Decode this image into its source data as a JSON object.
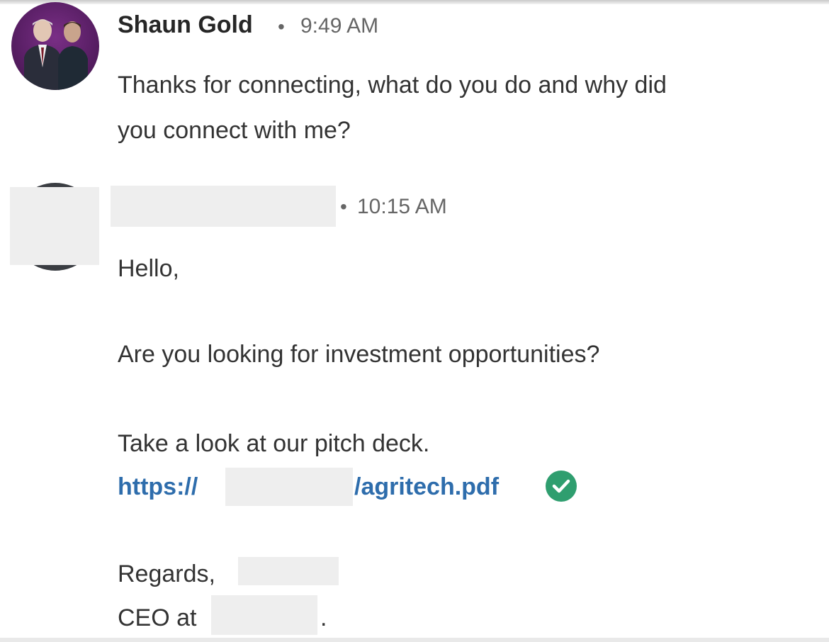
{
  "messages": [
    {
      "sender": "Shaun Gold",
      "separator": "•",
      "time": "9:49 AM",
      "avatar_icon": "profile-photo-two-men",
      "lines": [
        "Thanks for connecting, what do you do and why did",
        "you connect with me?"
      ]
    },
    {
      "sender": "",
      "separator": "•",
      "time": "10:15 AM",
      "avatar_icon": "profile-photo-redacted",
      "greeting": "Hello,",
      "question": "Are you looking for investment opportunities?",
      "pitch": "Take a look at our pitch deck.",
      "link_prefix": "https://",
      "link_suffix": "/agritech.pdf",
      "verified_icon": "check-circle-icon",
      "sign_off": "Regards,",
      "title_prefix": "CEO at",
      "title_suffix": "."
    }
  ],
  "colors": {
    "link": "#2e6dac",
    "verified": "#2f9e6f",
    "avatar_bg": "#5a1f66",
    "redaction": "#eeeeee"
  }
}
